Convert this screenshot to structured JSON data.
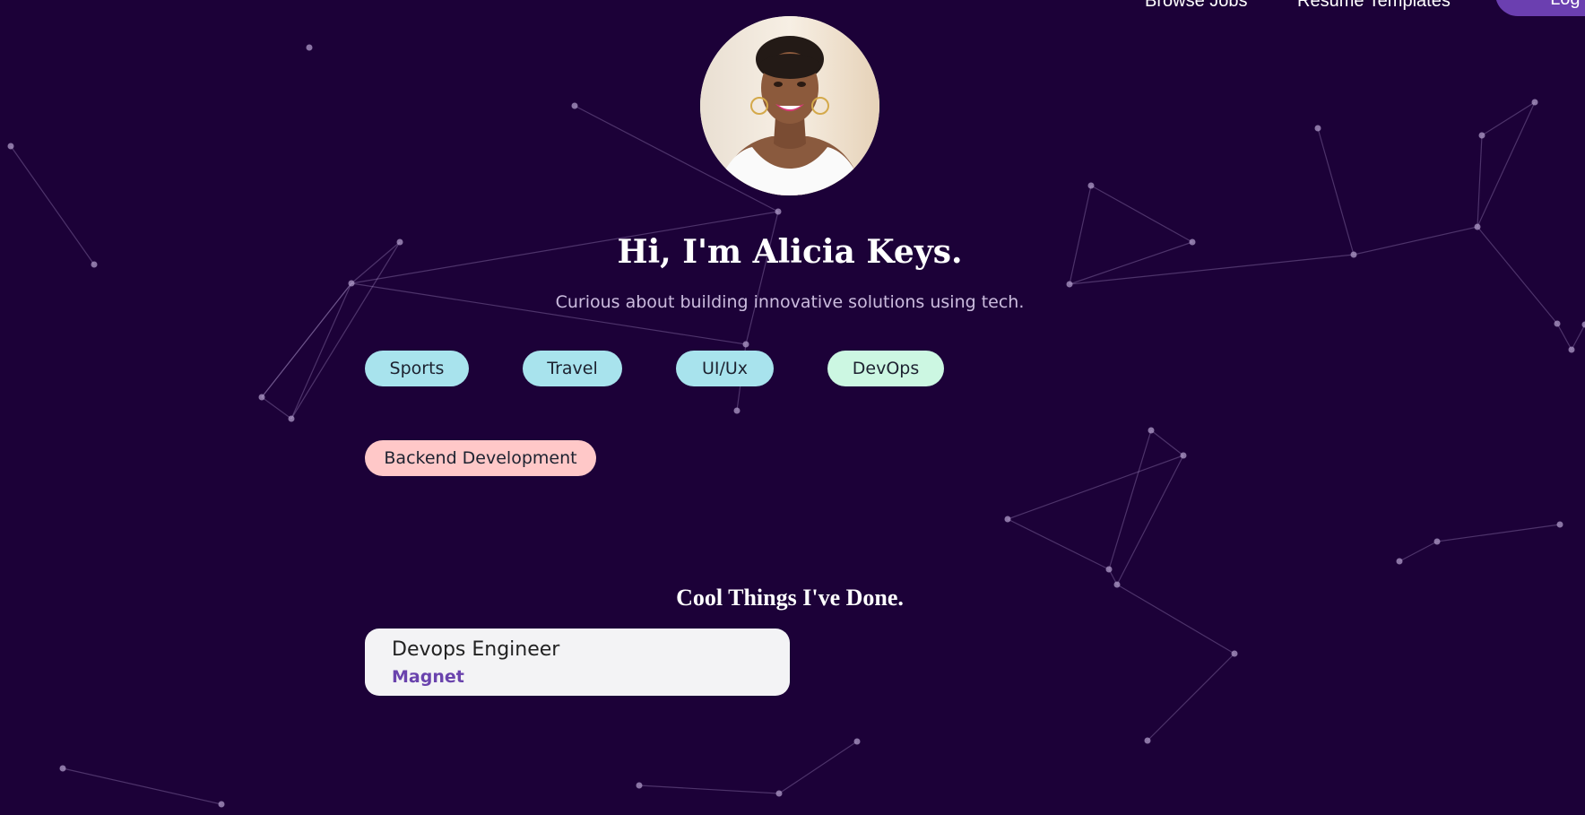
{
  "nav": {
    "browse_jobs": "Browse Jobs",
    "resume_templates": "Resume Templates",
    "login": "Log In"
  },
  "profile": {
    "avatar_alt": "Profile photo",
    "heading": "Hi, I'm Alicia Keys.",
    "tagline": "Curious about building innovative solutions using tech."
  },
  "interests": [
    {
      "label": "Sports",
      "color": "#a8e3ed"
    },
    {
      "label": "Travel",
      "color": "#a8e3ed"
    },
    {
      "label": "UI/Ux",
      "color": "#a8e3ed"
    },
    {
      "label": "DevOps",
      "color": "#ccf7e2"
    },
    {
      "label": "Backend Development",
      "color": "#ffc8c8"
    }
  ],
  "experience": {
    "section_title": "Cool Things I've Done.",
    "items": [
      {
        "role": "Devops Engineer",
        "company": "Magnet"
      }
    ]
  },
  "colors": {
    "background": "#1c0138",
    "accent": "#6a43ad",
    "button": "#6b3fb0"
  }
}
